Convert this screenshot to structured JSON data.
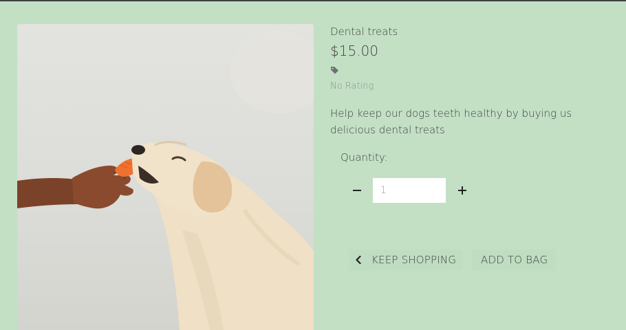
{
  "product": {
    "name": "Dental treats",
    "price": "$15.00",
    "tag_icon": "tag-icon",
    "rating": "No Rating",
    "description": "Help keep our dogs teeth healthy by buying us delicious dental treats",
    "image_alt": "Dog eating a carrot treat from a hand"
  },
  "quantity": {
    "label": "Quantity:",
    "value": "1",
    "decrement_icon": "minus-icon",
    "increment_icon": "plus-icon"
  },
  "actions": {
    "keep_shopping": "KEEP SHOPPING",
    "keep_shopping_icon": "chevron-left-icon",
    "add_to_bag": "ADD TO BAG"
  },
  "colors": {
    "background": "#c3e0c5",
    "text": "#3f3f3f",
    "muted": "#8a8f8a",
    "carrot": "#f0712f"
  }
}
